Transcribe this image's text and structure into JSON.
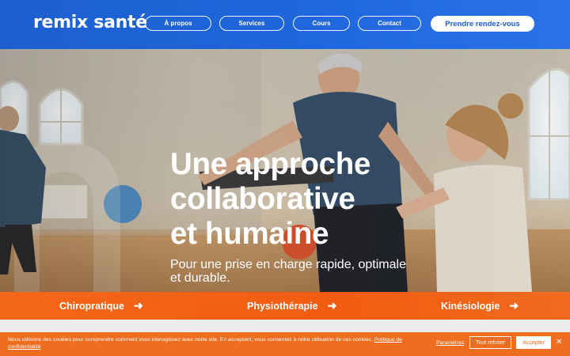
{
  "header": {
    "logo": "remix santé",
    "nav": [
      "À propos",
      "Services",
      "Cours",
      "Contact"
    ],
    "cta": "Prendre rendez-vous"
  },
  "hero": {
    "headline": [
      "Une approche",
      "collaborative",
      "et humaine"
    ],
    "subtitle": "Pour une prise en charge rapide, optimale et durable."
  },
  "services": [
    {
      "label": "Chiropratique",
      "icon": "arrow-right-icon"
    },
    {
      "label": "Physiothérapie",
      "icon": "arrow-right-icon"
    },
    {
      "label": "Kinésiologie",
      "icon": "arrow-right-icon"
    }
  ],
  "cookie": {
    "text": "Nous utilisons des cookies pour comprendre comment vous interagissez avec notre site. En acceptant, vous consentez à notre utilisation de ces cookies.",
    "policy_link": "Politique de confidentialité",
    "settings": "Paramètres",
    "refuse": "Tout refuser",
    "accept": "Accepter",
    "close_icon": "close-icon"
  },
  "colors": {
    "brand_blue": "#1c5fd0",
    "brand_orange": "#f46719"
  }
}
